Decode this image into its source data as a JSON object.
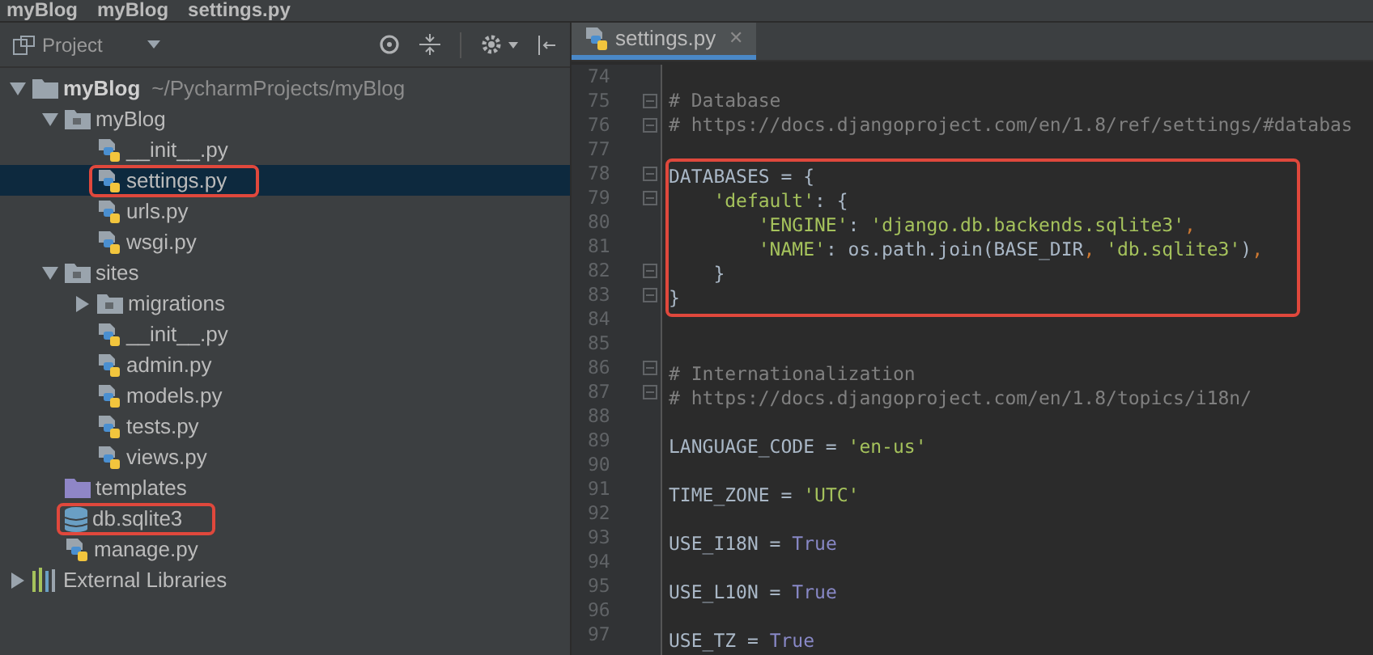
{
  "breadcrumbs": [
    "myBlog",
    "myBlog",
    "settings.py"
  ],
  "project_panel": {
    "title": "Project",
    "tree": [
      {
        "label": "myBlog",
        "path": "~/PycharmProjects/myBlog",
        "kind": "project",
        "expanded": true,
        "selected": false,
        "highlighted": false,
        "children": [
          {
            "label": "myBlog",
            "kind": "folder",
            "expanded": true,
            "selected": false,
            "highlighted": false,
            "children": [
              {
                "label": "__init__.py",
                "kind": "python",
                "selected": false,
                "highlighted": false
              },
              {
                "label": "settings.py",
                "kind": "python",
                "selected": true,
                "highlighted": true
              },
              {
                "label": "urls.py",
                "kind": "python",
                "selected": false,
                "highlighted": false
              },
              {
                "label": "wsgi.py",
                "kind": "python",
                "selected": false,
                "highlighted": false
              }
            ]
          },
          {
            "label": "sites",
            "kind": "folder",
            "expanded": true,
            "selected": false,
            "highlighted": false,
            "children": [
              {
                "label": "migrations",
                "kind": "folder",
                "expanded": false,
                "selected": false,
                "highlighted": false
              },
              {
                "label": "__init__.py",
                "kind": "python",
                "selected": false,
                "highlighted": false
              },
              {
                "label": "admin.py",
                "kind": "python",
                "selected": false,
                "highlighted": false
              },
              {
                "label": "models.py",
                "kind": "python",
                "selected": false,
                "highlighted": false
              },
              {
                "label": "tests.py",
                "kind": "python",
                "selected": false,
                "highlighted": false
              },
              {
                "label": "views.py",
                "kind": "python",
                "selected": false,
                "highlighted": false
              }
            ]
          },
          {
            "label": "templates",
            "kind": "template-folder",
            "selected": false,
            "highlighted": false
          },
          {
            "label": "db.sqlite3",
            "kind": "database",
            "selected": false,
            "highlighted": true
          },
          {
            "label": "manage.py",
            "kind": "python",
            "selected": false,
            "highlighted": false
          }
        ]
      },
      {
        "label": "External Libraries",
        "kind": "libraries",
        "expanded": false,
        "selected": false,
        "highlighted": false
      }
    ]
  },
  "editor": {
    "tabs": [
      {
        "label": "settings.py",
        "close": "✕",
        "selected": true
      }
    ],
    "lines": [
      {
        "number": "74",
        "fold": false,
        "boxed": false
      },
      {
        "number": "75",
        "fold": true,
        "boxed": false,
        "tokens": [
          {
            "kind": "comment",
            "text": "# Database"
          }
        ]
      },
      {
        "number": "76",
        "fold": true,
        "boxed": false,
        "tokens": [
          {
            "kind": "comment",
            "text": "# https://docs.djangoproject.com/en/1.8/ref/settings/#databas"
          }
        ]
      },
      {
        "number": "77",
        "fold": false,
        "boxed": false
      },
      {
        "number": "78",
        "fold": true,
        "boxed": true,
        "tokens": [
          {
            "kind": "plain",
            "text": "DATABASES = {"
          }
        ]
      },
      {
        "number": "79",
        "fold": true,
        "boxed": true,
        "tokens": [
          {
            "kind": "string",
            "text": "    'default'"
          },
          {
            "kind": "plain",
            "text": ": {"
          }
        ]
      },
      {
        "number": "80",
        "fold": false,
        "boxed": true,
        "tokens": [
          {
            "kind": "string",
            "text": "        'ENGINE'"
          },
          {
            "kind": "plain",
            "text": ": "
          },
          {
            "kind": "string",
            "text": "'django.db.backends.sqlite3'"
          },
          {
            "kind": "punct",
            "text": ","
          }
        ]
      },
      {
        "number": "81",
        "fold": false,
        "boxed": true,
        "tokens": [
          {
            "kind": "string",
            "text": "        'NAME'"
          },
          {
            "kind": "plain",
            "text": ": os.path.join(BASE_DIR"
          },
          {
            "kind": "punct",
            "text": ", "
          },
          {
            "kind": "string",
            "text": "'db.sqlite3'"
          },
          {
            "kind": "plain",
            "text": ")"
          },
          {
            "kind": "punct",
            "text": ","
          }
        ]
      },
      {
        "number": "82",
        "fold": true,
        "boxed": true,
        "tokens": [
          {
            "kind": "plain",
            "text": "    }"
          }
        ]
      },
      {
        "number": "83",
        "fold": true,
        "boxed": true,
        "tokens": [
          {
            "kind": "plain",
            "text": "}"
          }
        ]
      },
      {
        "number": "84",
        "fold": false,
        "boxed": false
      },
      {
        "number": "85",
        "fold": false,
        "boxed": false
      },
      {
        "number": "86",
        "fold": true,
        "boxed": false,
        "tokens": [
          {
            "kind": "comment",
            "text": "# Internationalization"
          }
        ]
      },
      {
        "number": "87",
        "fold": true,
        "boxed": false,
        "tokens": [
          {
            "kind": "comment",
            "text": "# https://docs.djangoproject.com/en/1.8/topics/i18n/"
          }
        ]
      },
      {
        "number": "88",
        "fold": false,
        "boxed": false
      },
      {
        "number": "89",
        "fold": false,
        "boxed": false,
        "tokens": [
          {
            "kind": "plain",
            "text": "LANGUAGE_CODE = "
          },
          {
            "kind": "string",
            "text": "'en-us'"
          }
        ]
      },
      {
        "number": "90",
        "fold": false,
        "boxed": false
      },
      {
        "number": "91",
        "fold": false,
        "boxed": false,
        "tokens": [
          {
            "kind": "plain",
            "text": "TIME_ZONE = "
          },
          {
            "kind": "string",
            "text": "'UTC'"
          }
        ]
      },
      {
        "number": "92",
        "fold": false,
        "boxed": false
      },
      {
        "number": "93",
        "fold": false,
        "boxed": false,
        "tokens": [
          {
            "kind": "plain",
            "text": "USE_I18N = "
          },
          {
            "kind": "keyword",
            "text": "True"
          }
        ]
      },
      {
        "number": "94",
        "fold": false,
        "boxed": false
      },
      {
        "number": "95",
        "fold": false,
        "boxed": false,
        "tokens": [
          {
            "kind": "plain",
            "text": "USE_L10N = "
          },
          {
            "kind": "keyword",
            "text": "True"
          }
        ]
      },
      {
        "number": "96",
        "fold": false,
        "boxed": false
      },
      {
        "number": "97",
        "fold": false,
        "boxed": false,
        "tokens": [
          {
            "kind": "plain",
            "text": "USE_TZ = "
          },
          {
            "kind": "keyword",
            "text": "True"
          }
        ]
      }
    ]
  }
}
